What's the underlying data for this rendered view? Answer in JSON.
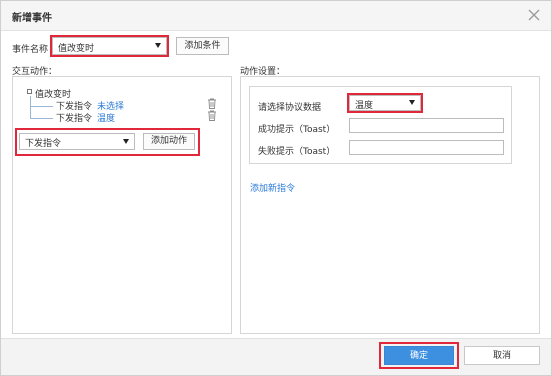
{
  "dialog": {
    "title": "新增事件"
  },
  "event": {
    "name_label": "事件名称",
    "name_value": "值改变时",
    "add_condition_label": "添加条件"
  },
  "interaction": {
    "section_label": "交互动作：",
    "tree": {
      "root_label": "值改变时",
      "items": [
        {
          "action": "下发指令",
          "value": "未选择"
        },
        {
          "action": "下发指令",
          "value": "温度"
        }
      ]
    },
    "action_select_value": "下发指令",
    "add_action_label": "添加动作"
  },
  "settings": {
    "section_label": "动作设置：",
    "protocol_label": "请选择协议数据",
    "protocol_value": "温度",
    "success_label": "成功提示（Toast）",
    "success_value": "",
    "fail_label": "失败提示（Toast）",
    "fail_value": "",
    "add_command_link": "添加新指令"
  },
  "footer": {
    "ok_label": "确定",
    "cancel_label": "取消"
  },
  "colors": {
    "accent": "#3d8fe0",
    "highlight": "#e0283a",
    "link": "#2a7ad8"
  }
}
